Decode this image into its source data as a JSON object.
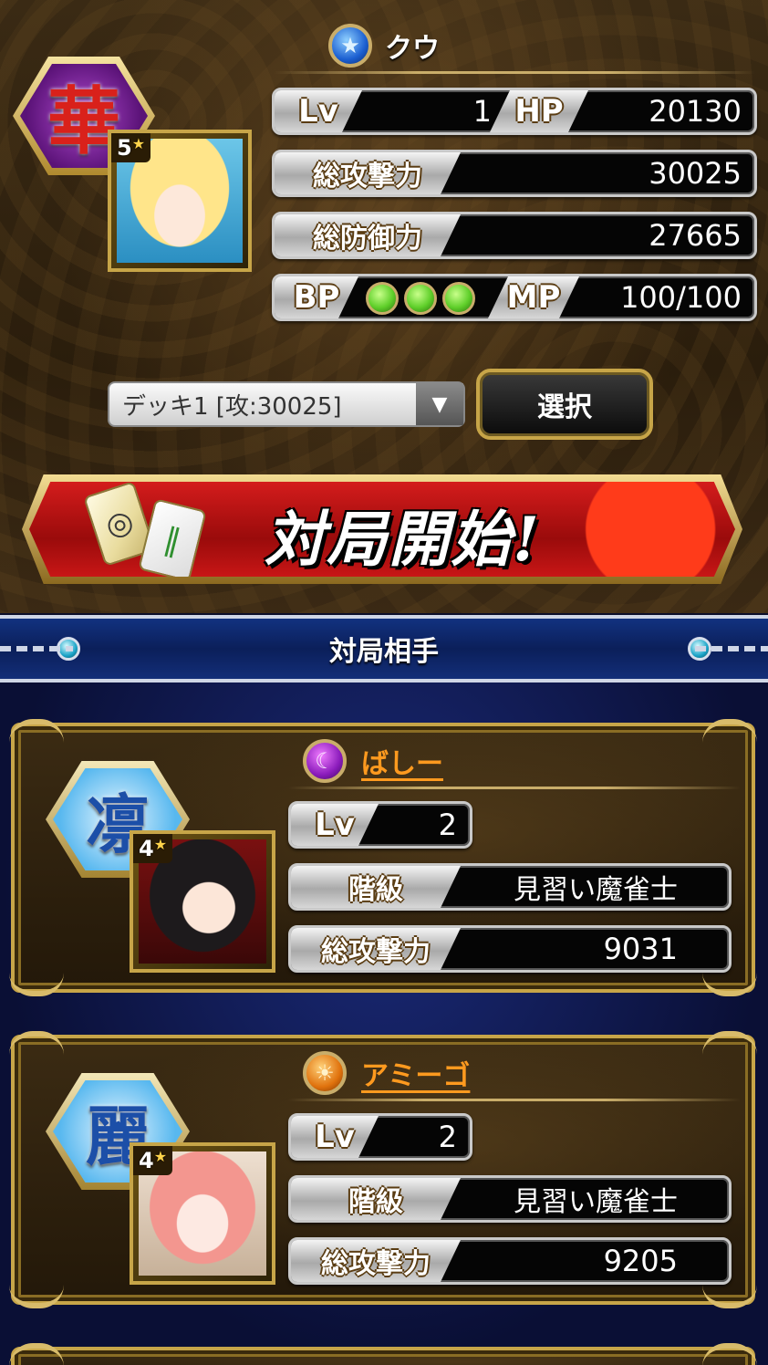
{
  "player": {
    "name": "クウ",
    "attribute_icon": "star-orb-icon",
    "emblem_glyph": "華",
    "rarity": "5",
    "stats": {
      "lv_label": "Lv",
      "lv_value": "1",
      "hp_label": "HP",
      "hp_value": "20130",
      "attack_label": "総攻撃力",
      "attack_value": "30025",
      "defense_label": "総防御力",
      "defense_value": "27665",
      "bp_label": "BP",
      "bp_count": 3,
      "mp_label": "MP",
      "mp_value": "100/100"
    }
  },
  "deck": {
    "selected": "デッキ1 [攻:30025]",
    "select_button_label": "選択"
  },
  "start_button_label": "対局開始!",
  "opponents_header": "対局相手",
  "opponents": [
    {
      "name": "ばしー",
      "attribute_icon": "moon-orb-icon",
      "emblem_glyph": "凛",
      "rarity": "4",
      "lv_label": "Lv",
      "lv_value": "2",
      "rank_label": "階級",
      "rank_value": "見習い魔雀士",
      "attack_label": "総攻撃力",
      "attack_value": "9031"
    },
    {
      "name": "アミーゴ",
      "attribute_icon": "sun-orb-icon",
      "emblem_glyph": "麗",
      "rarity": "4",
      "lv_label": "Lv",
      "lv_value": "2",
      "rank_label": "階級",
      "rank_value": "見習い魔雀士",
      "attack_label": "総攻撃力",
      "attack_value": "9205"
    }
  ],
  "colors": {
    "gold_frame": "#c7a548",
    "opponent_name": "#ff9a1f",
    "banner_red": "#c81616",
    "header_blue": "#0b1f5a",
    "bp_green": "#5fcf2a"
  }
}
